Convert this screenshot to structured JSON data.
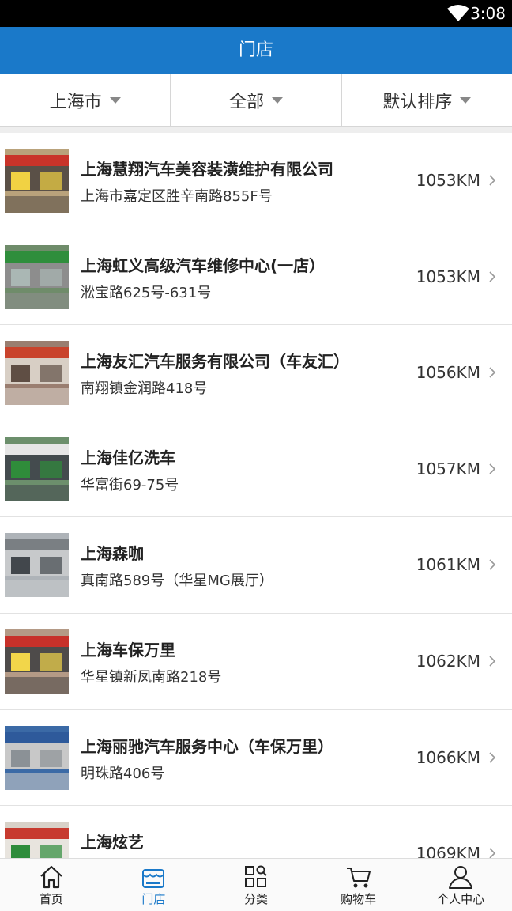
{
  "status_bar": {
    "time": "3:08"
  },
  "header": {
    "title": "门店"
  },
  "filters": [
    {
      "label": "上海市"
    },
    {
      "label": "全部"
    },
    {
      "label": "默认排序"
    }
  ],
  "stores": [
    {
      "name": "上海慧翔汽车美容装潢维护有限公司",
      "address": "上海市嘉定区胜辛南路855F号",
      "distance": "1053KM",
      "photo_colors": [
        "#b9a27b",
        "#c9342a",
        "#f1d243",
        "#5a5047"
      ]
    },
    {
      "name": "上海虹义高级汽车维修中心(一店）",
      "address": "淞宝路625号-631号",
      "distance": "1053KM",
      "photo_colors": [
        "#6f8c6a",
        "#2f8e3c",
        "#aab7b4",
        "#8d8d8d"
      ]
    },
    {
      "name": "上海友汇汽车服务有限公司（车友汇）",
      "address": "南翔镇金润路418号",
      "distance": "1056KM",
      "photo_colors": [
        "#9a7e70",
        "#c9432c",
        "#5f4e44",
        "#d8cfc5"
      ]
    },
    {
      "name": "上海佳亿洗车",
      "address": "华富街69-75号",
      "distance": "1057KM",
      "photo_colors": [
        "#6c8f6c",
        "#e6e6e6",
        "#2f8c3a",
        "#444b4e"
      ]
    },
    {
      "name": "上海森咖",
      "address": "真南路589号（华星MG展厅）",
      "distance": "1061KM",
      "photo_colors": [
        "#aeb3b8",
        "#7a7f83",
        "#42474c",
        "#c7c9cb"
      ]
    },
    {
      "name": "上海车保万里",
      "address": "华星镇新凤南路218号",
      "distance": "1062KM",
      "photo_colors": [
        "#b49a86",
        "#c7312a",
        "#f2d64a",
        "#4e4b4a"
      ]
    },
    {
      "name": "上海丽驰汽车服务中心（车保万里）",
      "address": "明珠路406号",
      "distance": "1066KM",
      "photo_colors": [
        "#3b6aa6",
        "#2e5a9b",
        "#8b9196",
        "#c8c8c8"
      ]
    },
    {
      "name": "上海炫艺",
      "address": "",
      "distance": "1069KM",
      "photo_colors": [
        "#d8d1c8",
        "#c73a2f",
        "#2e8c3b",
        "#e8e4de"
      ]
    }
  ],
  "tabs": [
    {
      "label": "首页",
      "icon": "home-icon",
      "active": false
    },
    {
      "label": "门店",
      "icon": "store-icon",
      "active": true
    },
    {
      "label": "分类",
      "icon": "category-icon",
      "active": false
    },
    {
      "label": "购物车",
      "icon": "cart-icon",
      "active": false
    },
    {
      "label": "个人中心",
      "icon": "user-icon",
      "active": false
    }
  ],
  "colors": {
    "header_blue": "#1a79c9",
    "active_tab": "#1a79c9"
  }
}
